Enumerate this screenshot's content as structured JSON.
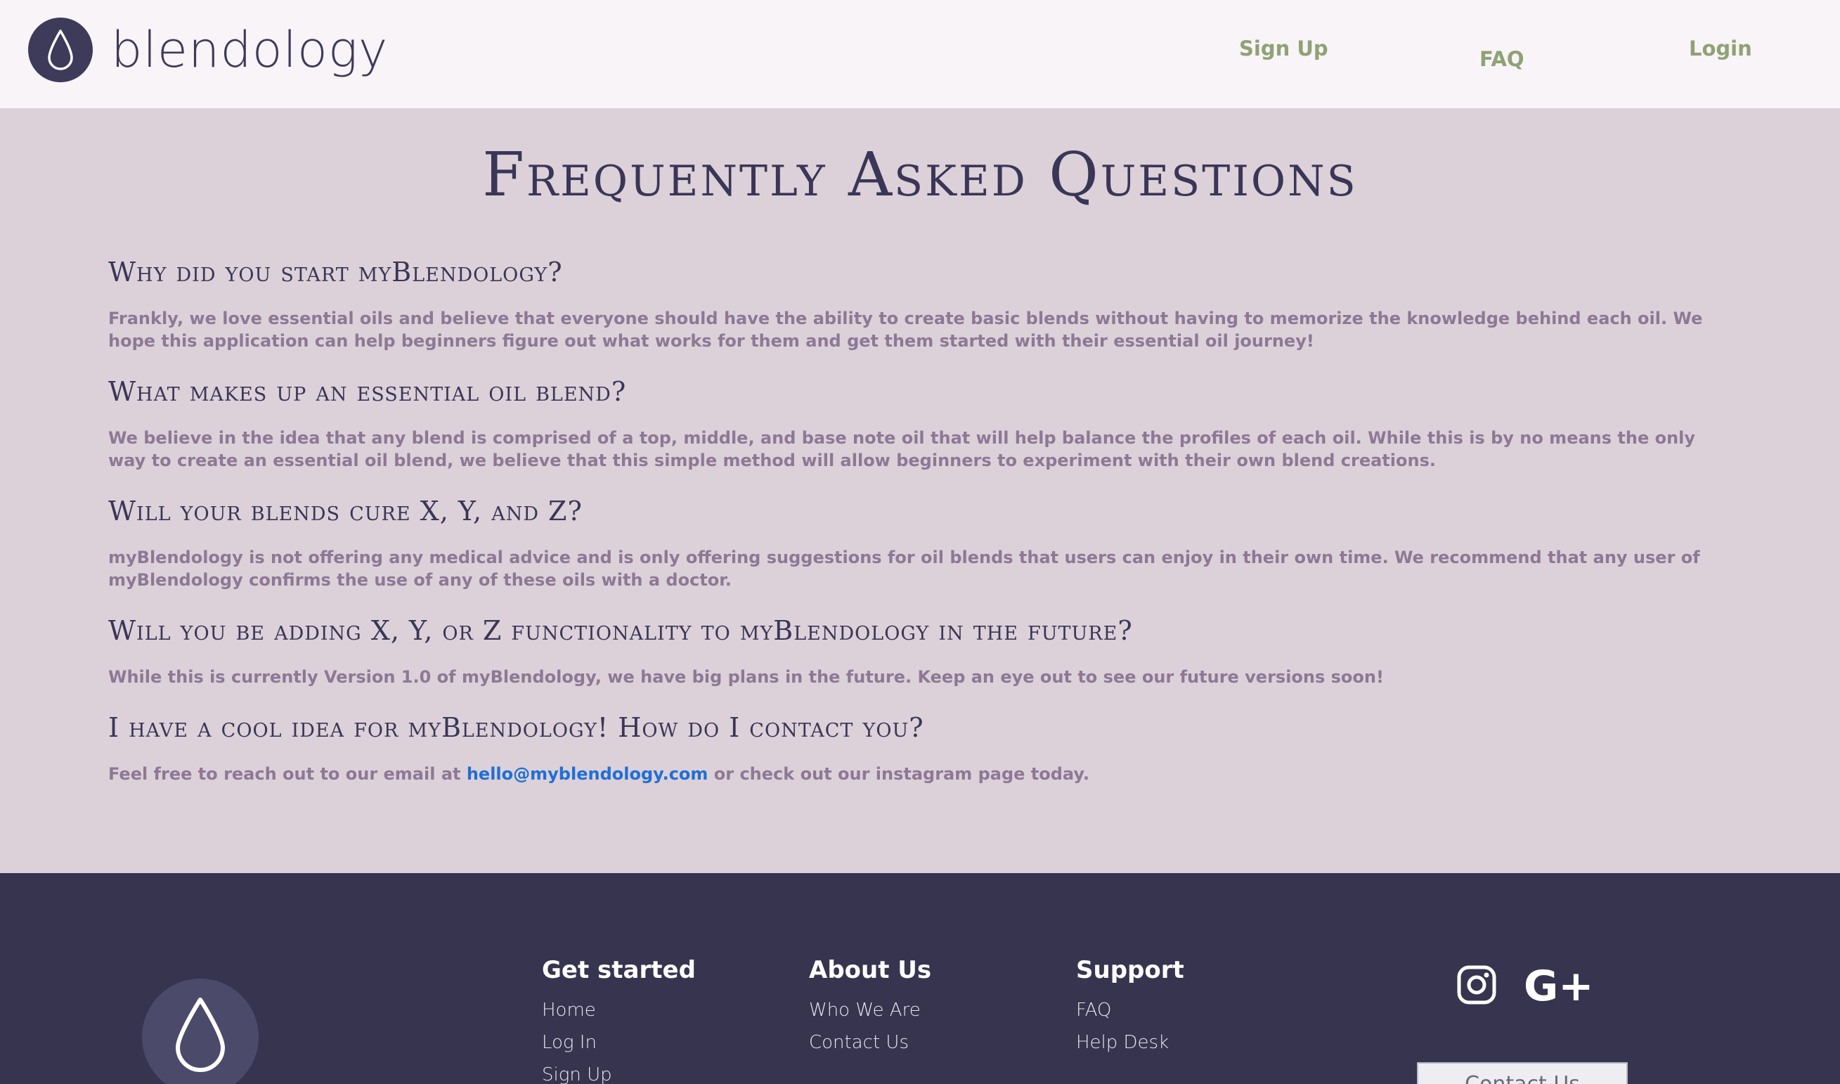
{
  "header": {
    "brand": "blendology",
    "nav": [
      {
        "label": "Sign Up"
      },
      {
        "label": "FAQ"
      },
      {
        "label": "Login"
      }
    ]
  },
  "main": {
    "title": "Frequently Asked Questions",
    "faqs": [
      {
        "question": "Why did you start myBlendology?",
        "answer": "Frankly, we love essential oils and believe that everyone should have the ability to create basic blends without having to memorize the knowledge behind each oil. We hope this application can help beginners figure out what works for them and get them started with their essential oil journey!"
      },
      {
        "question": "What makes up an essential oil blend?",
        "answer": "We believe in the idea that any blend is comprised of a top, middle, and base note oil that will help balance the profiles of each oil. While this is by no means the only way to create an essential oil blend, we believe that this simple method will allow beginners to experiment with their own blend creations."
      },
      {
        "question": "Will your blends cure X, Y, and Z?",
        "answer": "myBlendology is not offering any medical advice and is only offering suggestions for oil blends that users can enjoy in their own time. We recommend that any user of myBlendology confirms the use of any of these oils with a doctor."
      },
      {
        "question": "Will you be adding X, Y, or Z functionality to myBlendology in the future?",
        "answer": "While this is currently Version 1.0 of myBlendology, we have big plans in the future. Keep an eye out to see our future versions soon!"
      },
      {
        "question": "I have a cool idea for myBlendology! How do I contact you?",
        "answer_prefix": "Feel free to reach out to our email at ",
        "email": "hello@myblendology.com",
        "answer_suffix": " or check out our instagram page today."
      }
    ]
  },
  "footer": {
    "columns": [
      {
        "heading": "Get started",
        "links": [
          "Home",
          "Log In",
          "Sign Up"
        ]
      },
      {
        "heading": "About Us",
        "links": [
          "Who We Are",
          "Contact Us"
        ]
      },
      {
        "heading": "Support",
        "links": [
          "FAQ",
          "Help Desk"
        ]
      }
    ],
    "social_icons": [
      "instagram-icon",
      "google-plus-icon"
    ],
    "gplus_glyph": "G+",
    "contact_button": "Contact Us"
  },
  "colors": {
    "header_bg": "#f8f4f8",
    "page_bg": "#dcd1d8",
    "brand_purple": "#3d3a5a",
    "nav_green": "#8fa274",
    "answer_text": "#8e7896",
    "link_blue": "#1f6fd6",
    "footer_bg": "#36344f"
  }
}
